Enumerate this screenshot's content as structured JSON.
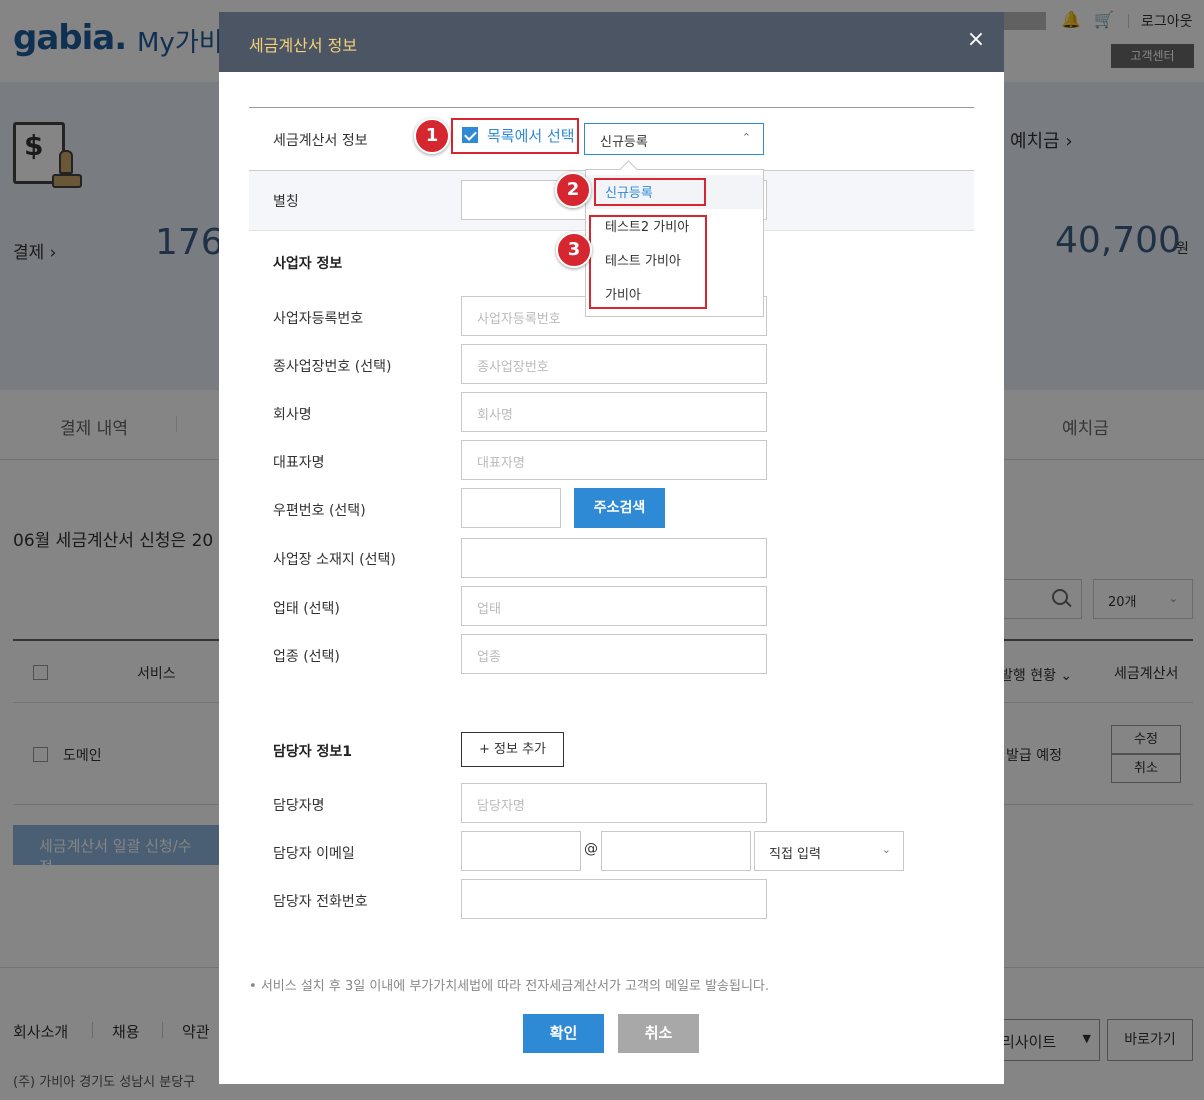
{
  "background": {
    "logo": "gabia.",
    "logo_sub": "My가비",
    "logout": "로그아웃",
    "customer_center": "고객센터",
    "summary_left_label": "결제",
    "summary_left_value": "176",
    "summary_right_title": "예치금",
    "summary_right_value": "40,700",
    "summary_right_unit": "원",
    "tab_left": "결제 내역",
    "tab_right": "예치금",
    "notice": "06월 세금계산서 신청은 20",
    "count_select": "20개",
    "th_service": "서비스",
    "th_status": "발행 현황",
    "th_invoice": "세금계산서",
    "row_service": "도메인",
    "row_status": "발급 예정",
    "row_edit": "수정",
    "row_cancel": "취소",
    "bulk_button": "세금계산서 일괄 신청/수정",
    "footer_links": [
      "회사소개",
      "채용",
      "약관"
    ],
    "footer_address": "(주) 가비아     경기도 성남시 분당구",
    "footer_site_select": "리사이트",
    "footer_go": "바로가기"
  },
  "modal": {
    "title": "세금계산서 정보",
    "close_label": "×",
    "invoice_info_label": "세금계산서 정보",
    "select_from_list": "목록에서 선택",
    "register_select_value": "신규등록",
    "alias_label": "별칭",
    "business_section": "사업자 정보",
    "fields": {
      "biz_number": {
        "label": "사업자등록번호",
        "placeholder": "사업자등록번호"
      },
      "branch_number": {
        "label": "종사업장번호 (선택)",
        "placeholder": "종사업장번호"
      },
      "company": {
        "label": "회사명",
        "placeholder": "회사명"
      },
      "ceo": {
        "label": "대표자명",
        "placeholder": "대표자명"
      },
      "zipcode": {
        "label": "우편번호 (선택)",
        "placeholder": ""
      },
      "address": {
        "label": "사업장 소재지 (선택)",
        "placeholder": ""
      },
      "biz_type": {
        "label": "업태 (선택)",
        "placeholder": "업태"
      },
      "biz_item": {
        "label": "업종 (선택)",
        "placeholder": "업종"
      }
    },
    "address_search": "주소검색",
    "contact_section": "담당자 정보1",
    "add_info": "정보 추가",
    "contact_name": {
      "label": "담당자명",
      "placeholder": "담당자명"
    },
    "contact_email_label": "담당자 이메일",
    "email_at": "@",
    "email_domain_select": "직접 입력",
    "contact_phone_label": "담당자 전화번호",
    "notice": "서비스 설치 후 3일 이내에 부가가치세법에 따라 전자세금계산서가 고객의 메일로 발송됩니다.",
    "confirm": "확인",
    "cancel": "취소"
  },
  "dropdown": {
    "items": [
      "신규등록",
      "테스트2 가비아",
      "테스트 가비아",
      "가비아"
    ],
    "selected_index": 0
  },
  "annotations": [
    "1",
    "2",
    "3"
  ],
  "colors": {
    "accent": "#2f8ad6",
    "header": "#4b5564",
    "title": "#f4d07a",
    "highlight": "#d6262f"
  }
}
